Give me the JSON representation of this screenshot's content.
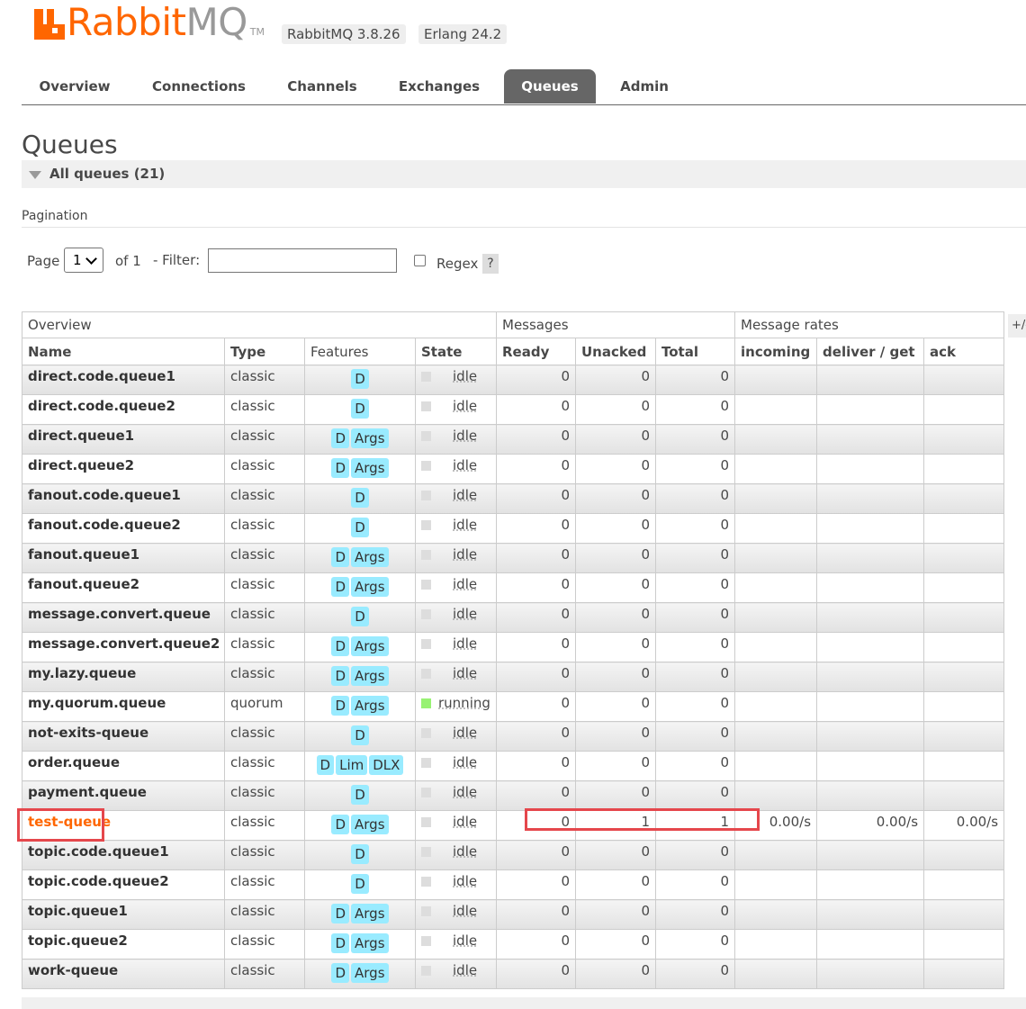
{
  "header": {
    "logo_rabbit": "Rabbit",
    "logo_mq": "MQ",
    "logo_tm": "TM",
    "version_rabbitmq": "RabbitMQ 3.8.26",
    "version_erlang": "Erlang 24.2"
  },
  "tabs": [
    "Overview",
    "Connections",
    "Channels",
    "Exchanges",
    "Queues",
    "Admin"
  ],
  "active_tab": "Queues",
  "page_title": "Queues",
  "section": {
    "label": "All queues (21)"
  },
  "pagination": {
    "label": "Pagination",
    "page_label": "Page",
    "page_value": "1",
    "of_label": "of 1",
    "filter_label": "- Filter:",
    "filter_value": "",
    "regex_label": "Regex",
    "help": "?"
  },
  "table": {
    "group_headers": [
      "Overview",
      "Messages",
      "Message rates"
    ],
    "columns": [
      "Name",
      "Type",
      "Features",
      "State",
      "Ready",
      "Unacked",
      "Total",
      "incoming",
      "deliver / get",
      "ack"
    ],
    "plus_minus": "+/-",
    "rows": [
      {
        "name": "direct.code.queue1",
        "type": "classic",
        "features": [
          "D"
        ],
        "state": "idle",
        "ready": "0",
        "unacked": "0",
        "total": "0",
        "incoming": "",
        "deliver_get": "",
        "ack": ""
      },
      {
        "name": "direct.code.queue2",
        "type": "classic",
        "features": [
          "D"
        ],
        "state": "idle",
        "ready": "0",
        "unacked": "0",
        "total": "0",
        "incoming": "",
        "deliver_get": "",
        "ack": ""
      },
      {
        "name": "direct.queue1",
        "type": "classic",
        "features": [
          "D",
          "Args"
        ],
        "state": "idle",
        "ready": "0",
        "unacked": "0",
        "total": "0",
        "incoming": "",
        "deliver_get": "",
        "ack": ""
      },
      {
        "name": "direct.queue2",
        "type": "classic",
        "features": [
          "D",
          "Args"
        ],
        "state": "idle",
        "ready": "0",
        "unacked": "0",
        "total": "0",
        "incoming": "",
        "deliver_get": "",
        "ack": ""
      },
      {
        "name": "fanout.code.queue1",
        "type": "classic",
        "features": [
          "D"
        ],
        "state": "idle",
        "ready": "0",
        "unacked": "0",
        "total": "0",
        "incoming": "",
        "deliver_get": "",
        "ack": ""
      },
      {
        "name": "fanout.code.queue2",
        "type": "classic",
        "features": [
          "D"
        ],
        "state": "idle",
        "ready": "0",
        "unacked": "0",
        "total": "0",
        "incoming": "",
        "deliver_get": "",
        "ack": ""
      },
      {
        "name": "fanout.queue1",
        "type": "classic",
        "features": [
          "D",
          "Args"
        ],
        "state": "idle",
        "ready": "0",
        "unacked": "0",
        "total": "0",
        "incoming": "",
        "deliver_get": "",
        "ack": ""
      },
      {
        "name": "fanout.queue2",
        "type": "classic",
        "features": [
          "D",
          "Args"
        ],
        "state": "idle",
        "ready": "0",
        "unacked": "0",
        "total": "0",
        "incoming": "",
        "deliver_get": "",
        "ack": ""
      },
      {
        "name": "message.convert.queue",
        "type": "classic",
        "features": [
          "D"
        ],
        "state": "idle",
        "ready": "0",
        "unacked": "0",
        "total": "0",
        "incoming": "",
        "deliver_get": "",
        "ack": ""
      },
      {
        "name": "message.convert.queue2",
        "type": "classic",
        "features": [
          "D",
          "Args"
        ],
        "state": "idle",
        "ready": "0",
        "unacked": "0",
        "total": "0",
        "incoming": "",
        "deliver_get": "",
        "ack": ""
      },
      {
        "name": "my.lazy.queue",
        "type": "classic",
        "features": [
          "D",
          "Args"
        ],
        "state": "idle",
        "ready": "0",
        "unacked": "0",
        "total": "0",
        "incoming": "",
        "deliver_get": "",
        "ack": ""
      },
      {
        "name": "my.quorum.queue",
        "type": "quorum",
        "features": [
          "D",
          "Args"
        ],
        "state": "running",
        "ready": "0",
        "unacked": "0",
        "total": "0",
        "incoming": "",
        "deliver_get": "",
        "ack": ""
      },
      {
        "name": "not-exits-queue",
        "type": "classic",
        "features": [
          "D"
        ],
        "state": "idle",
        "ready": "0",
        "unacked": "0",
        "total": "0",
        "incoming": "",
        "deliver_get": "",
        "ack": ""
      },
      {
        "name": "order.queue",
        "type": "classic",
        "features": [
          "D",
          "Lim",
          "DLX"
        ],
        "state": "idle",
        "ready": "0",
        "unacked": "0",
        "total": "0",
        "incoming": "",
        "deliver_get": "",
        "ack": ""
      },
      {
        "name": "payment.queue",
        "type": "classic",
        "features": [
          "D"
        ],
        "state": "idle",
        "ready": "0",
        "unacked": "0",
        "total": "0",
        "incoming": "",
        "deliver_get": "",
        "ack": ""
      },
      {
        "name": "test-queue",
        "type": "classic",
        "features": [
          "D",
          "Args"
        ],
        "state": "idle",
        "ready": "0",
        "unacked": "1",
        "total": "1",
        "incoming": "0.00/s",
        "deliver_get": "0.00/s",
        "ack": "0.00/s",
        "highlight": true
      },
      {
        "name": "topic.code.queue1",
        "type": "classic",
        "features": [
          "D"
        ],
        "state": "idle",
        "ready": "0",
        "unacked": "0",
        "total": "0",
        "incoming": "",
        "deliver_get": "",
        "ack": ""
      },
      {
        "name": "topic.code.queue2",
        "type": "classic",
        "features": [
          "D"
        ],
        "state": "idle",
        "ready": "0",
        "unacked": "0",
        "total": "0",
        "incoming": "",
        "deliver_get": "",
        "ack": ""
      },
      {
        "name": "topic.queue1",
        "type": "classic",
        "features": [
          "D",
          "Args"
        ],
        "state": "idle",
        "ready": "0",
        "unacked": "0",
        "total": "0",
        "incoming": "",
        "deliver_get": "",
        "ack": ""
      },
      {
        "name": "topic.queue2",
        "type": "classic",
        "features": [
          "D",
          "Args"
        ],
        "state": "idle",
        "ready": "0",
        "unacked": "0",
        "total": "0",
        "incoming": "",
        "deliver_get": "",
        "ack": ""
      },
      {
        "name": "work-queue",
        "type": "classic",
        "features": [
          "D",
          "Args"
        ],
        "state": "idle",
        "ready": "0",
        "unacked": "0",
        "total": "0",
        "incoming": "",
        "deliver_get": "",
        "ack": ""
      }
    ]
  },
  "colors": {
    "brand": "#ff6600",
    "tab_active": "#666666",
    "feature_badge": "#99ebff",
    "running": "#98f273",
    "highlight_box": "#e5474c"
  }
}
